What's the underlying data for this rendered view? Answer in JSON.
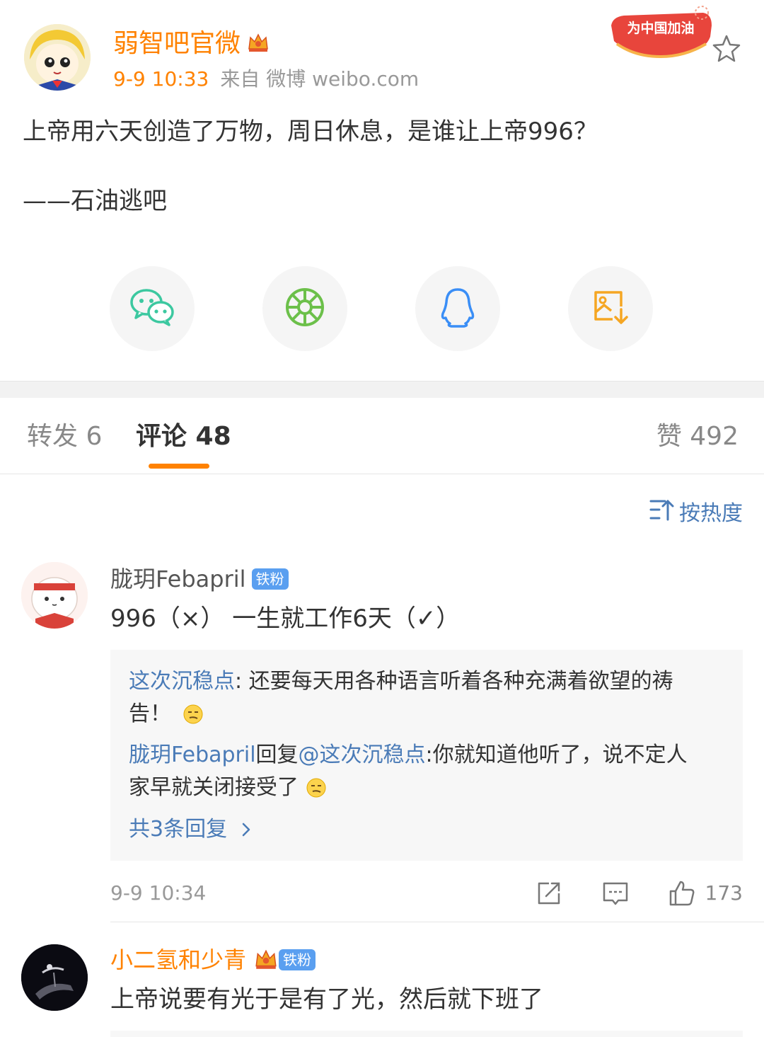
{
  "post": {
    "author": "弱智吧官微",
    "time": "9-9 10:33",
    "source": "来自 微博 weibo.com",
    "campaign_badge": "为中国加油",
    "text": "上帝用六天创造了万物，周日休息，是谁让上帝996？",
    "signature": "——石油逃吧"
  },
  "share": {
    "items": [
      {
        "name": "wechat",
        "icon": "wechat-icon"
      },
      {
        "name": "moments",
        "icon": "moments-icon"
      },
      {
        "name": "qq",
        "icon": "qq-icon"
      },
      {
        "name": "save-image",
        "icon": "save-image-icon"
      }
    ]
  },
  "tabs": {
    "repost": "转发 6",
    "comments": "评论 48",
    "likes": "赞 492"
  },
  "sort": {
    "label": "按热度"
  },
  "comments": [
    {
      "name": "胧玥Febapril",
      "badge": "铁粉",
      "text": "996（×） 一生就工作6天（✓）",
      "time": "9-9 10:34",
      "likes": "173",
      "replies": {
        "r1_user": "这次沉稳点",
        "r1_text_line1": ": 还要每天用各种语言听着各种充满着欲望的祷",
        "r1_text_line2": "告！",
        "r2_user": "胧玥Febapril",
        "r2_mid": "回复",
        "r2_target": "@这次沉稳点",
        "r2_text_line1": ":你就知道他听了，说不定人",
        "r2_text_line2": "家早就关闭接受了",
        "more": "共3条回复"
      }
    },
    {
      "name": "小二氢和少青",
      "badge": "铁粉",
      "text": "上帝说要有光于是有了光，然后就下班了"
    }
  ],
  "colors": {
    "accent": "#ff8200",
    "link": "#4a7bb7",
    "badge": "#5a9ff0"
  }
}
